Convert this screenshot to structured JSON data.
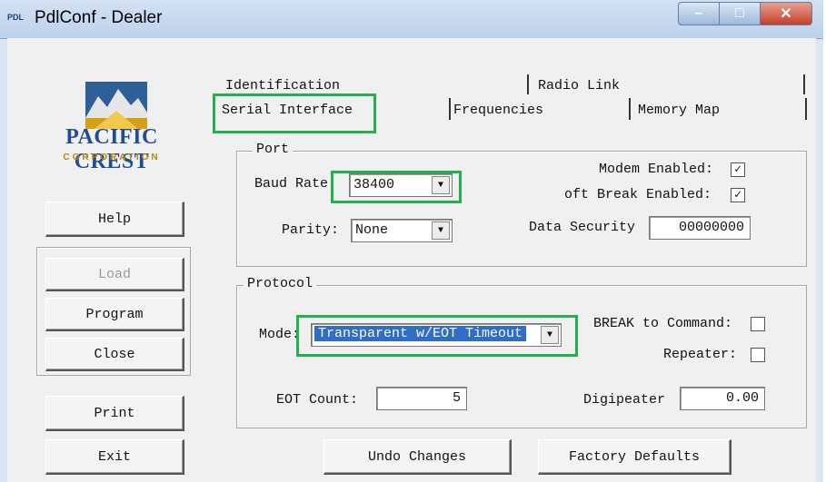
{
  "window": {
    "app_icon_text": "PDL",
    "title": "PdlConf - Dealer"
  },
  "logo": {
    "name": "PACIFIC CREST",
    "corporation": "CORPORATION"
  },
  "left_buttons": {
    "help": "Help",
    "load": "Load",
    "program": "Program",
    "close": "Close",
    "print": "Print",
    "exit": "Exit"
  },
  "tabs": {
    "identification": "Identification",
    "radio_link": "Radio Link",
    "serial_interface": "Serial Interface",
    "frequencies": "Frequencies",
    "memory_map": "Memory Map",
    "selected": "Serial Interface"
  },
  "port": {
    "group_label": "Port",
    "baud_rate_label": "Baud Rate:",
    "baud_rate_value": "38400",
    "parity_label": "Parity:",
    "parity_value": "None",
    "modem_enabled_label": "Modem Enabled:",
    "modem_enabled_checked": true,
    "soft_break_label": "oft Break Enabled:",
    "soft_break_checked": true,
    "data_security_label": "Data Security",
    "data_security_value": "00000000"
  },
  "protocol": {
    "group_label": "Protocol",
    "mode_label": "Mode:",
    "mode_value": "Transparent w/EOT Timeout",
    "break_to_command_label": "BREAK to Command:",
    "break_to_command_checked": false,
    "repeater_label": "Repeater:",
    "repeater_checked": false,
    "eot_count_label": "EOT Count:",
    "eot_count_value": "5",
    "digipeater_label": "Digipeater",
    "digipeater_value": "0.00"
  },
  "bottom_buttons": {
    "undo_changes": "Undo Changes",
    "factory_defaults": "Factory Defaults"
  },
  "colors": {
    "highlight": "#22b14c",
    "selection": "#2f6dc8",
    "brand_blue": "#1f4d8f",
    "brand_gold": "#b8860b"
  },
  "icons": {
    "minimize": "minimize-icon",
    "maximize": "maximize-icon",
    "close": "close-icon",
    "dropdown": "chevron-down-icon",
    "check": "checkmark-icon"
  }
}
